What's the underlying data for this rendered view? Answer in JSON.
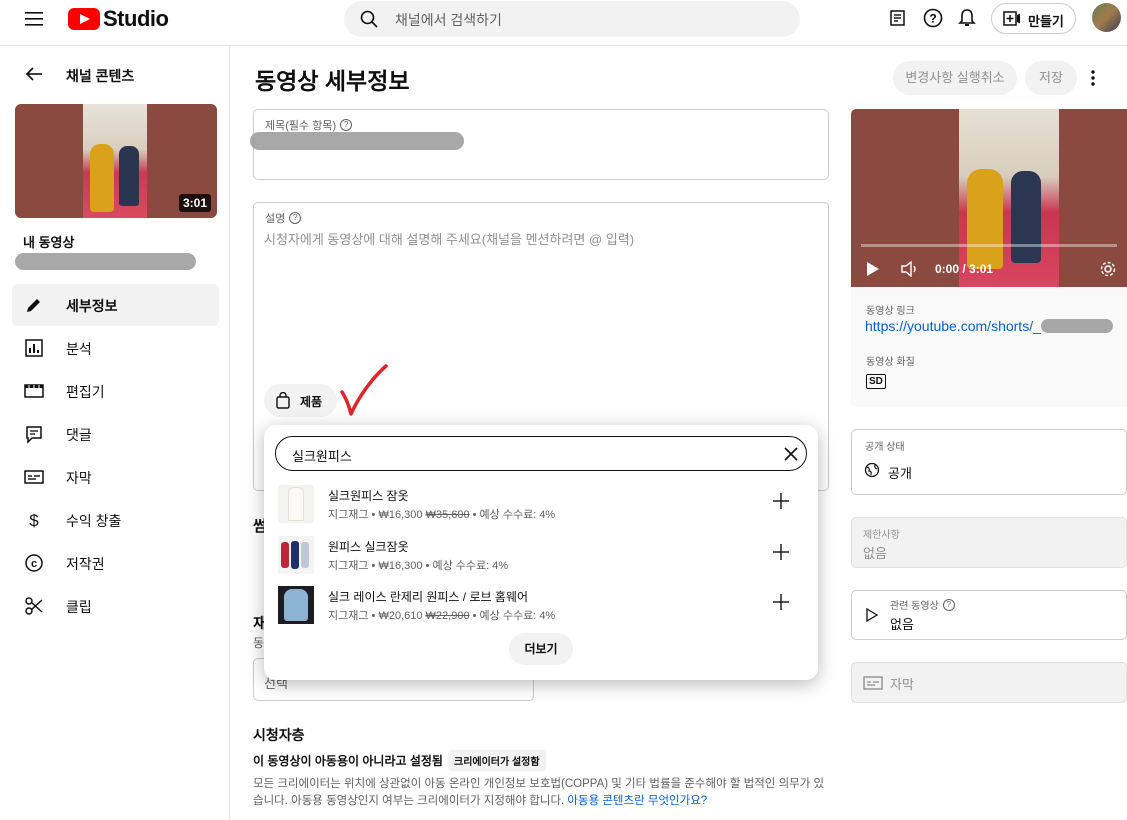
{
  "topbar": {
    "logo_text": "Studio",
    "search_placeholder": "채널에서 검색하기",
    "make_label": "만들기"
  },
  "sidebar": {
    "back_title": "채널 콘텐츠",
    "thumb_duration": "3:01",
    "my_video_label": "내 동영상",
    "items": [
      {
        "label": "세부정보",
        "icon": "pencil-icon"
      },
      {
        "label": "분석",
        "icon": "analytics-icon"
      },
      {
        "label": "편집기",
        "icon": "editor-icon"
      },
      {
        "label": "댓글",
        "icon": "comments-icon"
      },
      {
        "label": "자막",
        "icon": "subtitles-icon"
      },
      {
        "label": "수익 창출",
        "icon": "dollar-icon"
      },
      {
        "label": "저작권",
        "icon": "copyright-icon"
      },
      {
        "label": "클립",
        "icon": "scissors-icon"
      }
    ]
  },
  "main": {
    "page_title": "동영상 세부정보",
    "undo_label": "변경사항 실행취소",
    "save_label": "저장",
    "title_field_label": "제목(필수 항목)",
    "description_label": "설명",
    "description_placeholder": "시청자에게 동영상에 대해 설명해 주세요(채널을 멘션하려면 @ 입력)",
    "products_chip": "제품",
    "thumbnail_heading_partial": "썸",
    "playlist_heading_partial": "재",
    "playlist_sub_partial": "동",
    "playlist_select_partial": "선택",
    "audience_heading": "시청자층",
    "audience_setting": "이 동영상이 아동용이 아니라고 설정됨",
    "audience_badge": "크리에이터가 설정함",
    "audience_desc": "모든 크리에이터는 위치에 상관없이 아동 온라인 개인정보 보호법(COPPA) 및 기타 법률을 준수해야 할 법적인 의무가 있습니다. 아동용 동영상인지 여부는 크리에이터가 지정해야 합니다.",
    "audience_link": "아동용 콘텐츠란 무엇인가요?"
  },
  "product_panel": {
    "search_value": "실크원피스",
    "more_label": "더보기",
    "products": [
      {
        "name": "실크원피스 잠옷",
        "seller": "지그재그",
        "price": "₩16,300",
        "original": "₩35,600",
        "commission": "예상 수수료: 4%"
      },
      {
        "name": "원피스 실크잠옷",
        "seller": "지그재그",
        "price": "₩16,300",
        "original": "",
        "commission": "예상 수수료: 4%"
      },
      {
        "name": "실크 레이스 란제리 원피스 / 로브 홈웨어",
        "seller": "지그재그",
        "price": "₩20,610",
        "original": "₩22,900",
        "commission": "예상 수수료: 4%"
      }
    ]
  },
  "right": {
    "player_time": "0:00 / 3:01",
    "link_label": "동영상 링크",
    "link_value": "https://youtube.com/shorts/_",
    "quality_label": "동영상 화질",
    "quality_badge": "SD",
    "visibility_label": "공개 상태",
    "visibility_value": "공개",
    "restrictions_label": "제한사항",
    "restrictions_value": "없음",
    "related_label": "관련 동영상",
    "related_value": "없음",
    "subtitles_label": "자막"
  },
  "colors": {
    "youtube_red": "#ff0000",
    "link_blue": "#065fd4",
    "annotation_red": "#e0242a"
  }
}
